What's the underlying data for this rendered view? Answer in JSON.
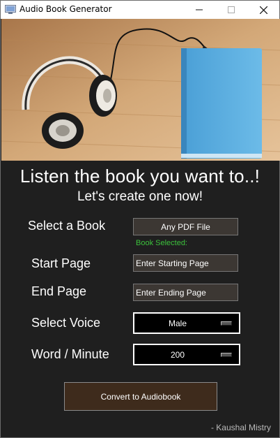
{
  "window": {
    "title": "Audio Book Generator",
    "icons": {
      "app": "app-icon",
      "minimize": "minimize-icon",
      "maximize": "maximize-icon",
      "close": "close-icon"
    }
  },
  "hero": {
    "image": "headphones-and-blue-book-photo"
  },
  "heading": {
    "title": "Listen the book you want to..!",
    "subtitle": "Let's create one now!"
  },
  "form": {
    "book": {
      "label": "Select a Book",
      "button": "Any PDF File",
      "status": "Book Selected:"
    },
    "start_page": {
      "label": "Start Page",
      "placeholder": "Enter Starting Page",
      "value": ""
    },
    "end_page": {
      "label": "End Page",
      "placeholder": "Enter Ending Page",
      "value": ""
    },
    "voice": {
      "label": "Select Voice",
      "selected": "Male"
    },
    "rate": {
      "label": "Word / Minute",
      "selected": "200"
    }
  },
  "actions": {
    "convert": "Convert to Audiobook"
  },
  "footer": {
    "credit": "- Kaushal Mistry"
  },
  "colors": {
    "background": "#1f1f1f",
    "status_green": "#3cc13c",
    "convert_button": "#3e2b1c",
    "field": "#3c3733"
  }
}
